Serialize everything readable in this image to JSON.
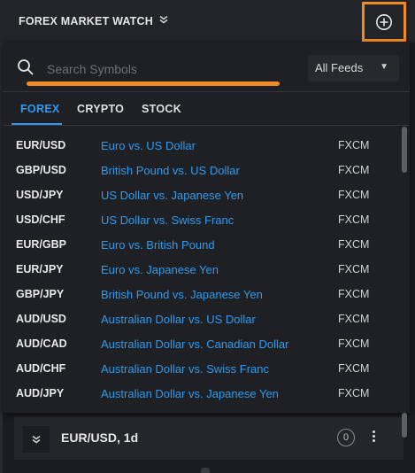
{
  "header": {
    "title": "FOREX MARKET WATCH",
    "collapse_icon": "double-chevron-down-icon",
    "add_icon": "plus-circle-icon"
  },
  "search": {
    "placeholder": "Search Symbols",
    "value": "",
    "icon": "search-icon"
  },
  "feed_select": {
    "selected": "All Feeds",
    "icon": "caret-down-icon"
  },
  "tabs": [
    {
      "label": "FOREX",
      "active": true
    },
    {
      "label": "CRYPTO",
      "active": false
    },
    {
      "label": "STOCK",
      "active": false
    }
  ],
  "symbols": [
    {
      "symbol": "EUR/USD",
      "description": "Euro vs. US Dollar",
      "feed": "FXCM"
    },
    {
      "symbol": "GBP/USD",
      "description": "British Pound vs. US Dollar",
      "feed": "FXCM"
    },
    {
      "symbol": "USD/JPY",
      "description": "US Dollar vs. Japanese Yen",
      "feed": "FXCM"
    },
    {
      "symbol": "USD/CHF",
      "description": "US Dollar vs. Swiss Franc",
      "feed": "FXCM"
    },
    {
      "symbol": "EUR/GBP",
      "description": "Euro vs. British Pound",
      "feed": "FXCM"
    },
    {
      "symbol": "EUR/JPY",
      "description": "Euro vs. Japanese Yen",
      "feed": "FXCM"
    },
    {
      "symbol": "GBP/JPY",
      "description": "British Pound vs. Japanese Yen",
      "feed": "FXCM"
    },
    {
      "symbol": "AUD/USD",
      "description": "Australian Dollar vs. US Dollar",
      "feed": "FXCM"
    },
    {
      "symbol": "AUD/CAD",
      "description": "Australian Dollar vs. Canadian Dollar",
      "feed": "FXCM"
    },
    {
      "symbol": "AUD/CHF",
      "description": "Australian Dollar vs. Swiss Franc",
      "feed": "FXCM"
    },
    {
      "symbol": "AUD/JPY",
      "description": "Australian Dollar vs. Japanese Yen",
      "feed": "FXCM"
    }
  ],
  "panel": {
    "title": "EUR/USD, 1d",
    "count": "0",
    "toggle_icon": "double-chevron-down-icon",
    "menu_icon": "kebab-menu-icon"
  },
  "colors": {
    "accent_blue": "#2d9bf0",
    "highlight_orange": "#f08a24",
    "background": "#1b1c20"
  }
}
